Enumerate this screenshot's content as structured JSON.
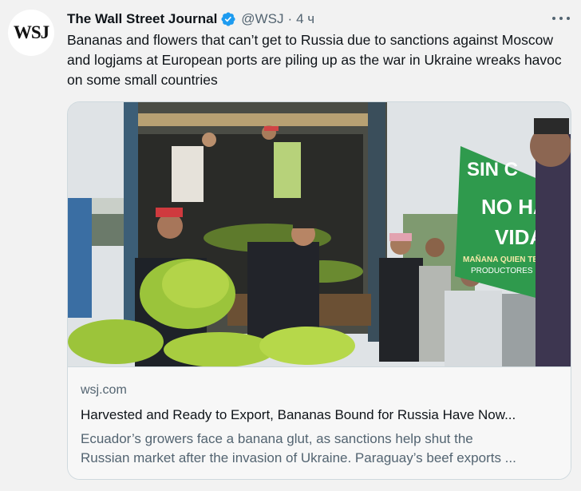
{
  "tweet": {
    "avatar_text": "WSJ",
    "author_name": "The Wall Street Journal",
    "handle": "@WSJ",
    "separator": "·",
    "timestamp": "4 ч",
    "text": "Bananas and flowers that can’t get to Russia due to sanctions against Moscow and logjams at European ports are piling up as the war in Ukraine wreaks havoc on some small countries",
    "verified_color": "#1d9bf0",
    "more_icon": "more-horizontal-icon"
  },
  "card": {
    "image_alt": "Workers unloading bananas from a truck beside a green protest banner",
    "banner_text": [
      "SIN C",
      "NO HA",
      "VIDA",
      "MAÑANA QUIEN TE DARÁ",
      "PRODUCTORES DE VER"
    ],
    "domain": "wsj.com",
    "title": "Harvested and Ready to Export, Bananas Bound for Russia Have Now...",
    "description_lines": [
      "Ecuador’s growers face a banana glut, as sanctions help shut the",
      "Russian market after the invasion of Ukraine. Paraguay’s beef exports ..."
    ]
  }
}
